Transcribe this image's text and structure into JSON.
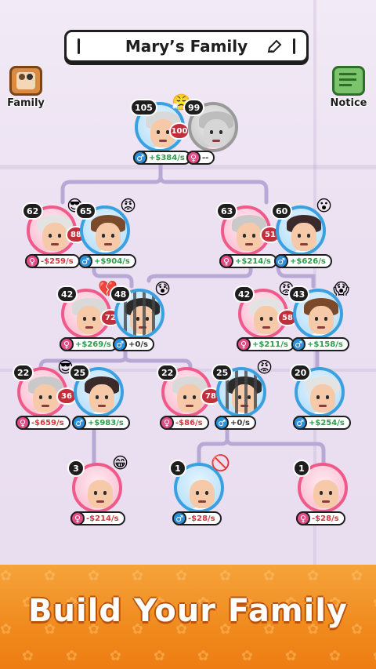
{
  "header": {
    "title": "Mary’s Family"
  },
  "side": {
    "family_label": "Family",
    "notice_label": "Notice"
  },
  "slogan": "Build Your Family",
  "members": [
    {
      "id": "gen1-m",
      "age": "105",
      "gender": "male",
      "income": "+$384/s",
      "emoji": "😤",
      "heart": "100"
    },
    {
      "id": "gen1-f",
      "age": "99",
      "gender": "female",
      "income": "--"
    },
    {
      "id": "gen2a-f",
      "age": "62",
      "gender": "female",
      "income": "-$259/s",
      "emoji": "😎",
      "heart": "88"
    },
    {
      "id": "gen2a-m",
      "age": "65",
      "gender": "male",
      "income": "+$904/s",
      "emoji": "😡"
    },
    {
      "id": "gen2b-f",
      "age": "63",
      "gender": "female",
      "income": "+$214/s",
      "heart": "51"
    },
    {
      "id": "gen2b-m",
      "age": "60",
      "gender": "male",
      "income": "+$626/s",
      "emoji": "😮"
    },
    {
      "id": "gen3a-f",
      "age": "42",
      "gender": "female",
      "income": "+$269/s",
      "emoji": "💔",
      "heart": "72"
    },
    {
      "id": "gen3a-m",
      "age": "48",
      "gender": "male",
      "income": "+0/s",
      "emoji": "😰"
    },
    {
      "id": "gen3b-f",
      "age": "42",
      "gender": "female",
      "income": "+$211/s",
      "emoji": "😡",
      "heart": "58"
    },
    {
      "id": "gen3b-m",
      "age": "43",
      "gender": "male",
      "income": "+$158/s",
      "emoji": "😱"
    },
    {
      "id": "gen4a-f",
      "age": "22",
      "gender": "female",
      "income": "-$659/s",
      "emoji": "😎",
      "heart": "36"
    },
    {
      "id": "gen4a-m",
      "age": "25",
      "gender": "male",
      "income": "+$983/s"
    },
    {
      "id": "gen4b-f",
      "age": "22",
      "gender": "female",
      "income": "-$86/s",
      "heart": "78"
    },
    {
      "id": "gen4b-m",
      "age": "25",
      "gender": "male",
      "income": "+0/s",
      "emoji": "😡"
    },
    {
      "id": "gen4c-m",
      "age": "20",
      "gender": "male",
      "income": "+$254/s"
    },
    {
      "id": "gen5a-f",
      "age": "3",
      "gender": "female",
      "income": "-$214/s",
      "emoji": "😁"
    },
    {
      "id": "gen5b-m",
      "age": "1",
      "gender": "male",
      "income": "-$28/s",
      "emoji": "🚫"
    },
    {
      "id": "gen5c-f",
      "age": "1",
      "gender": "female",
      "income": "-$28/s"
    }
  ],
  "colors": {
    "male": "#3aa0e0",
    "female": "#f05a8a",
    "banner": "#f08a1e",
    "positive": "#2c9d4a",
    "negative": "#d8353c"
  },
  "icons": {
    "edit": "pencil-icon",
    "family": "family-portrait-icon",
    "notice": "notebook-icon"
  }
}
